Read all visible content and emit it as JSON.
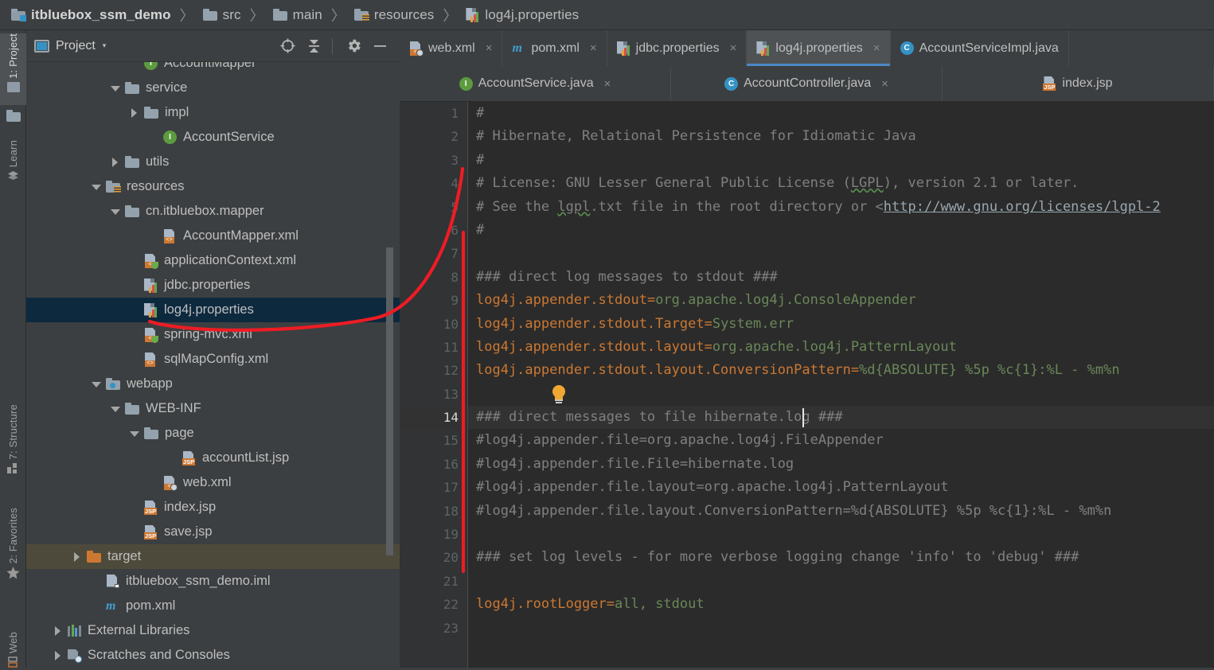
{
  "navbar": {
    "crumbs": [
      {
        "label": "itbluebox_ssm_demo",
        "icon": "module-folder-icon"
      },
      {
        "label": "src",
        "icon": "folder-icon"
      },
      {
        "label": "main",
        "icon": "folder-icon"
      },
      {
        "label": "resources",
        "icon": "resources-folder-icon"
      },
      {
        "label": "log4j.properties",
        "icon": "properties-file-icon"
      }
    ],
    "separator": "〉"
  },
  "toolstrip": {
    "items": [
      {
        "label": "1: Project",
        "icon": "project-icon",
        "selected": true
      },
      {
        "label": "",
        "icon": "folder-icon",
        "selected": false
      },
      {
        "label": "Learn",
        "icon": "learn-icon",
        "selected": false
      },
      {
        "label": "7: Structure",
        "icon": "structure-icon",
        "selected": false
      },
      {
        "label": "2: Favorites",
        "icon": "star-icon",
        "selected": false
      },
      {
        "label": "Web",
        "icon": "web-icon",
        "selected": false
      }
    ]
  },
  "project_panel": {
    "title": "Project",
    "caret": "▾",
    "actions": [
      {
        "name": "locate-icon",
        "tooltip": "Select Opened File"
      },
      {
        "name": "collapse-all-icon",
        "tooltip": "Collapse All"
      },
      {
        "name": "gear-icon",
        "tooltip": "Settings"
      },
      {
        "name": "minimize-icon",
        "tooltip": "Hide"
      }
    ],
    "tree": [
      {
        "label": "AccountMapper",
        "indent": 5,
        "twist": "none",
        "icon": "interface-icon",
        "state": "normal",
        "clipped": true
      },
      {
        "label": "service",
        "indent": 4,
        "twist": "down",
        "icon": "package-folder-icon",
        "state": "normal"
      },
      {
        "label": "impl",
        "indent": 5,
        "twist": "right",
        "icon": "package-folder-icon",
        "state": "normal"
      },
      {
        "label": "AccountService",
        "indent": 6,
        "twist": "none",
        "icon": "interface-icon",
        "state": "normal"
      },
      {
        "label": "utils",
        "indent": 4,
        "twist": "right",
        "icon": "package-folder-icon",
        "state": "normal"
      },
      {
        "label": "resources",
        "indent": 3,
        "twist": "down",
        "icon": "resources-folder-icon",
        "state": "normal"
      },
      {
        "label": "cn.itbluebox.mapper",
        "indent": 4,
        "twist": "down",
        "icon": "folder-icon",
        "state": "normal"
      },
      {
        "label": "AccountMapper.xml",
        "indent": 6,
        "twist": "none",
        "icon": "xml-code-icon",
        "state": "normal"
      },
      {
        "label": "applicationContext.xml",
        "indent": 5,
        "twist": "none",
        "icon": "xml-spring-icon",
        "state": "normal"
      },
      {
        "label": "jdbc.properties",
        "indent": 5,
        "twist": "none",
        "icon": "properties-file-icon",
        "state": "normal"
      },
      {
        "label": "log4j.properties",
        "indent": 5,
        "twist": "none",
        "icon": "properties-file-icon",
        "state": "selected"
      },
      {
        "label": "spring-mvc.xml",
        "indent": 5,
        "twist": "none",
        "icon": "xml-spring-icon",
        "state": "normal"
      },
      {
        "label": "sqlMapConfig.xml",
        "indent": 5,
        "twist": "none",
        "icon": "xml-code-icon",
        "state": "normal"
      },
      {
        "label": "webapp",
        "indent": 3,
        "twist": "down",
        "icon": "webapp-folder-icon",
        "state": "normal"
      },
      {
        "label": "WEB-INF",
        "indent": 4,
        "twist": "down",
        "icon": "folder-icon",
        "state": "normal"
      },
      {
        "label": "page",
        "indent": 5,
        "twist": "down",
        "icon": "folder-icon",
        "state": "normal"
      },
      {
        "label": "accountList.jsp",
        "indent": 7,
        "twist": "none",
        "icon": "jsp-file-icon",
        "state": "normal"
      },
      {
        "label": "web.xml",
        "indent": 6,
        "twist": "none",
        "icon": "xml-web-icon",
        "state": "normal"
      },
      {
        "label": "index.jsp",
        "indent": 5,
        "twist": "none",
        "icon": "jsp-file-icon",
        "state": "normal"
      },
      {
        "label": "save.jsp",
        "indent": 5,
        "twist": "none",
        "icon": "jsp-file-icon",
        "state": "normal"
      },
      {
        "label": "target",
        "indent": 2,
        "twist": "right",
        "icon": "orange-folder-icon",
        "state": "target"
      },
      {
        "label": "itbluebox_ssm_demo.iml",
        "indent": 3,
        "twist": "none",
        "icon": "iml-file-icon",
        "state": "normal"
      },
      {
        "label": "pom.xml",
        "indent": 3,
        "twist": "none",
        "icon": "maven-icon",
        "state": "normal"
      },
      {
        "label": "External Libraries",
        "indent": 1,
        "twist": "right",
        "icon": "libraries-icon",
        "state": "normal"
      },
      {
        "label": "Scratches and Consoles",
        "indent": 1,
        "twist": "right",
        "icon": "scratches-icon",
        "state": "normal"
      }
    ]
  },
  "editor": {
    "tabs_row1": [
      {
        "label": "web.xml",
        "icon": "xml-web-icon",
        "active": false,
        "close": "×"
      },
      {
        "label": "pom.xml",
        "icon": "maven-icon",
        "active": false,
        "close": "×"
      },
      {
        "label": "jdbc.properties",
        "icon": "properties-file-icon",
        "active": false,
        "close": "×"
      },
      {
        "label": "log4j.properties",
        "icon": "properties-file-icon",
        "active": true,
        "close": "×"
      },
      {
        "label": "AccountServiceImpl.java",
        "icon": "class-icon",
        "active": false,
        "close": ""
      }
    ],
    "tabs_row2": [
      {
        "label": "AccountService.java",
        "icon": "interface-icon",
        "active": false,
        "close": "×"
      },
      {
        "label": "AccountController.java",
        "icon": "class-icon",
        "active": false,
        "close": "×"
      },
      {
        "label": "index.jsp",
        "icon": "jsp-file-icon",
        "active": false,
        "close": ""
      }
    ],
    "current_line": 14,
    "lines": [
      {
        "n": 1,
        "segments": [
          {
            "t": "#",
            "c": "cmt"
          }
        ]
      },
      {
        "n": 2,
        "segments": [
          {
            "t": "# Hibernate, Relational Persistence for Idiomatic Java",
            "c": "cmt"
          }
        ]
      },
      {
        "n": 3,
        "segments": [
          {
            "t": "#",
            "c": "cmt"
          }
        ]
      },
      {
        "n": 4,
        "segments": [
          {
            "t": "# License: GNU Lesser General Public License (",
            "c": "cmt"
          },
          {
            "t": "LGPL",
            "c": "wavy"
          },
          {
            "t": "), version 2.1 or later.",
            "c": "cmt"
          }
        ]
      },
      {
        "n": 5,
        "segments": [
          {
            "t": "# See the ",
            "c": "cmt"
          },
          {
            "t": "lgpl",
            "c": "wavy"
          },
          {
            "t": ".txt file in the root directory or <",
            "c": "cmt"
          },
          {
            "t": "http://www.gnu.org/licenses/lgpl-2",
            "c": "lnk"
          }
        ]
      },
      {
        "n": 6,
        "segments": [
          {
            "t": "#",
            "c": "cmt"
          }
        ]
      },
      {
        "n": 7,
        "segments": []
      },
      {
        "n": 8,
        "segments": [
          {
            "t": "### direct log messages to stdout ###",
            "c": "cmt"
          }
        ]
      },
      {
        "n": 9,
        "segments": [
          {
            "t": "log4j.appender.stdout",
            "c": "k"
          },
          {
            "t": "=",
            "c": "k"
          },
          {
            "t": "org.apache.log4j.ConsoleAppender",
            "c": "v"
          }
        ]
      },
      {
        "n": 10,
        "segments": [
          {
            "t": "log4j.appender.stdout.Target",
            "c": "k"
          },
          {
            "t": "=",
            "c": "k"
          },
          {
            "t": "System.err",
            "c": "v"
          }
        ]
      },
      {
        "n": 11,
        "segments": [
          {
            "t": "log4j.appender.stdout.layout",
            "c": "k"
          },
          {
            "t": "=",
            "c": "k"
          },
          {
            "t": "org.apache.log4j.PatternLayout",
            "c": "v"
          }
        ]
      },
      {
        "n": 12,
        "segments": [
          {
            "t": "log4j.appender.stdout.layout.ConversionPattern",
            "c": "k"
          },
          {
            "t": "=",
            "c": "k"
          },
          {
            "t": "%d{ABSOLUTE} %5p %c{1}:%L - %m%n",
            "c": "v"
          }
        ]
      },
      {
        "n": 13,
        "segments": []
      },
      {
        "n": 14,
        "segments": [
          {
            "t": "### direct messages to file hibernate.log ###",
            "c": "cmt"
          }
        ]
      },
      {
        "n": 15,
        "segments": [
          {
            "t": "#log4j.appender.file=org.apache.log4j.FileAppender",
            "c": "cmt"
          }
        ]
      },
      {
        "n": 16,
        "segments": [
          {
            "t": "#log4j.appender.file.File=hibernate.log",
            "c": "cmt"
          }
        ]
      },
      {
        "n": 17,
        "segments": [
          {
            "t": "#log4j.appender.file.layout=org.apache.log4j.PatternLayout",
            "c": "cmt"
          }
        ]
      },
      {
        "n": 18,
        "segments": [
          {
            "t": "#log4j.appender.file.layout.ConversionPattern=%d{ABSOLUTE} %5p %c{1}:%L - %m%n",
            "c": "cmt"
          }
        ]
      },
      {
        "n": 19,
        "segments": []
      },
      {
        "n": 20,
        "segments": [
          {
            "t": "### set log levels - for more verbose logging change 'info' to 'debug' ###",
            "c": "cmt"
          }
        ]
      },
      {
        "n": 21,
        "segments": []
      },
      {
        "n": 22,
        "segments": [
          {
            "t": "log4j.rootLogger",
            "c": "k"
          },
          {
            "t": "=",
            "c": "k"
          },
          {
            "t": "all, stdout",
            "c": "v"
          }
        ]
      },
      {
        "n": 23,
        "segments": []
      }
    ],
    "hint_icon": "lightbulb-icon",
    "hint_line": 13
  },
  "annotation": {
    "color": "#ee1c24",
    "shapes": [
      "curve-from-log4j-properties-to-editor",
      "vertical-line-left-of-code"
    ]
  },
  "colors": {
    "panel_bg": "#3c3f41",
    "editor_bg": "#2b2b2b",
    "gutter_bg": "#313335",
    "selection_bg": "#0d293e",
    "target_bg": "#4e4a3b",
    "accent": "#4a88c7",
    "key": "#cc7832",
    "value": "#6a8759",
    "comment": "#808080",
    "annotation_red": "#ee1c24"
  }
}
